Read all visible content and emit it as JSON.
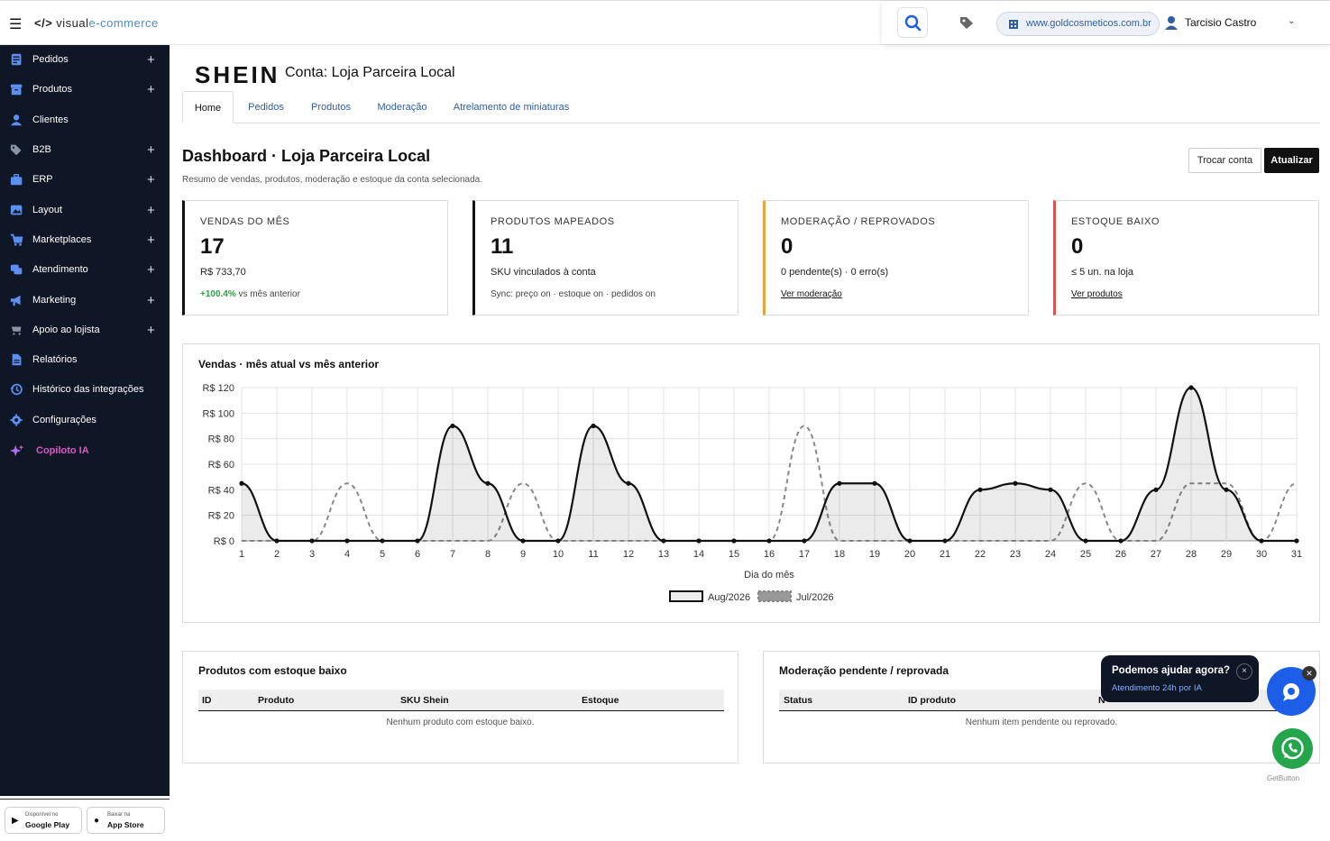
{
  "topbar": {
    "menu_icon": "hamburger-icon",
    "logo_main": "visual",
    "logo_accent": "e-commerce",
    "site_url": "www.goldcosmeticos.com.br",
    "user_name": "Tarcisio Castro"
  },
  "sidebar": {
    "items": [
      {
        "label": "Pedidos",
        "icon": "orders-icon",
        "expandable": true
      },
      {
        "label": "Produtos",
        "icon": "box-icon",
        "expandable": true
      },
      {
        "label": "Clientes",
        "icon": "user-icon",
        "expandable": false
      },
      {
        "label": "B2B",
        "icon": "tags-icon",
        "expandable": true
      },
      {
        "label": "ERP",
        "icon": "briefcase-icon",
        "expandable": true
      },
      {
        "label": "Layout",
        "icon": "image-icon",
        "expandable": true
      },
      {
        "label": "Marketplaces",
        "icon": "cart-icon",
        "expandable": true
      },
      {
        "label": "Atendimento",
        "icon": "chat-icon",
        "expandable": true
      },
      {
        "label": "Marketing",
        "icon": "megaphone-icon",
        "expandable": true
      },
      {
        "label": "Apoio ao lojista",
        "icon": "cart-small-icon",
        "expandable": true
      },
      {
        "label": "Relatórios",
        "icon": "document-icon",
        "expandable": false
      },
      {
        "label": "Histórico das integrações",
        "icon": "history-icon",
        "expandable": false
      },
      {
        "label": "Configurações",
        "icon": "gear-icon",
        "expandable": false
      },
      {
        "label": "Copiloto IA",
        "icon": "sparkle-icon",
        "expandable": false
      }
    ],
    "plus_symbol": "+",
    "google_play": {
      "small": "Disponível no",
      "big": "Google Play"
    },
    "app_store": {
      "small": "Baixar na",
      "big": "App Store"
    }
  },
  "header": {
    "brand": "SHEIN",
    "account": "Conta: Loja Parceira Local",
    "tabs": [
      "Home",
      "Pedidos",
      "Produtos",
      "Moderação",
      "Atrelamento de miniaturas"
    ],
    "active_tab": "Home"
  },
  "dashboard": {
    "title": "Dashboard · Loja Parceira Local",
    "subtitle": "Resumo de vendas, produtos, moderação e estoque da conta selecionada.",
    "btn_trocar": "Trocar conta",
    "btn_atualizar": "Atualizar"
  },
  "kpis": [
    {
      "title": "VENDAS DO MÊS",
      "value": "17",
      "sub": "R$ 733,70",
      "foot_strong": "+100.4%",
      "foot": " vs mês anterior",
      "accent": "#111111"
    },
    {
      "title": "PRODUTOS MAPEADOS",
      "value": "11",
      "sub": "SKU vinculados à conta",
      "foot": "Sync: preço on · estoque on · pedidos on",
      "accent": "#111111"
    },
    {
      "title": "MODERAÇÃO / REPROVADOS",
      "value": "0",
      "sub": "0 pendente(s) · 0 erro(s)",
      "foot_link": "Ver moderação",
      "accent": "#e8a33d"
    },
    {
      "title": "ESTOQUE BAIXO",
      "value": "0",
      "sub": "≤ 5 un. na loja",
      "foot_link": "Ver produtos",
      "accent": "#d9534f"
    }
  ],
  "chart_data": {
    "type": "line",
    "title": "Vendas · mês atual vs mês anterior",
    "xlabel": "Dia do mês",
    "ylabel": "",
    "x": [
      1,
      2,
      3,
      4,
      5,
      6,
      7,
      8,
      9,
      10,
      11,
      12,
      13,
      14,
      15,
      16,
      17,
      18,
      19,
      20,
      21,
      22,
      23,
      24,
      25,
      26,
      27,
      28,
      29,
      30,
      31
    ],
    "ylim": [
      0,
      120
    ],
    "yticks": [
      "R$ 0",
      "R$ 20",
      "R$ 40",
      "R$ 60",
      "R$ 80",
      "R$ 100",
      "R$ 120"
    ],
    "grid": true,
    "legend_position": "bottom",
    "series": [
      {
        "name": "Aug/2026",
        "style": "solid-filled",
        "color": "#111111",
        "values": [
          45,
          0,
          0,
          0,
          0,
          0,
          90,
          45,
          0,
          0,
          90,
          45,
          0,
          0,
          0,
          0,
          0,
          45,
          45,
          0,
          0,
          40,
          45,
          40,
          0,
          0,
          40,
          120,
          40,
          0,
          0
        ]
      },
      {
        "name": "Jul/2026",
        "style": "dashed",
        "color": "#888888",
        "values": [
          0,
          0,
          0,
          45,
          0,
          0,
          0,
          0,
          45,
          0,
          0,
          0,
          0,
          0,
          0,
          0,
          90,
          0,
          0,
          0,
          0,
          0,
          0,
          0,
          45,
          0,
          0,
          45,
          45,
          0,
          45
        ]
      }
    ]
  },
  "low_stock": {
    "title": "Produtos com estoque baixo",
    "columns": [
      "ID",
      "Produto",
      "SKU Shein",
      "Estoque"
    ],
    "empty": "Nenhum produto com estoque baixo."
  },
  "moderation": {
    "title": "Moderação pendente / reprovada",
    "columns": [
      "Status",
      "ID produto",
      "N"
    ],
    "empty": "Nenhum item pendente ou reprovado."
  },
  "chat": {
    "question": "Podemos ajudar agora?",
    "answer": "Atendimento 24h por IA",
    "close": "×",
    "getbutton": "GetButton"
  }
}
